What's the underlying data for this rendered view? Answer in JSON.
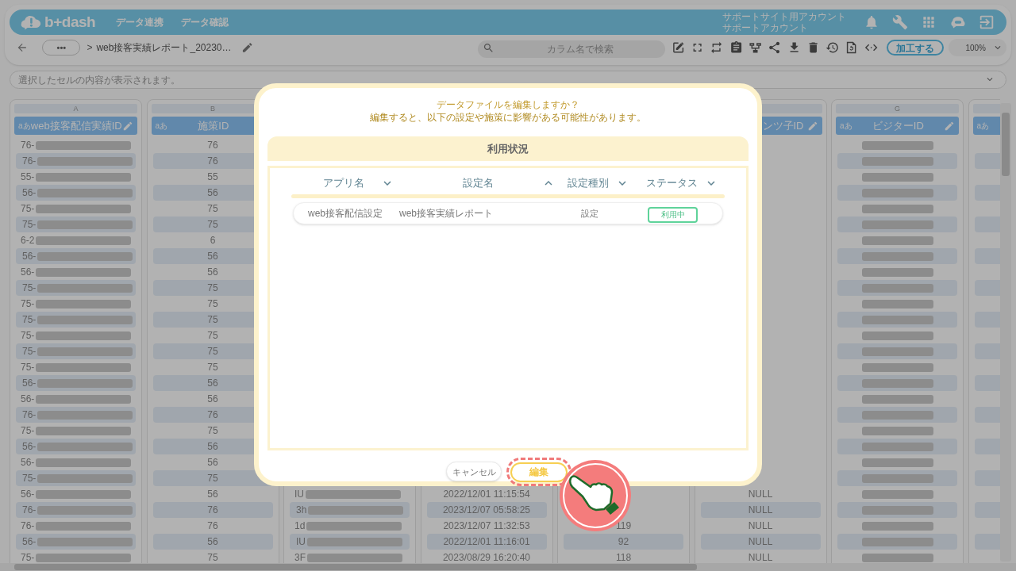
{
  "app_bar": {
    "logo": "b+dash",
    "nav": [
      "データ連携",
      "データ確認"
    ],
    "account": [
      "サポートサイト用アカウント",
      "サポートアカウント"
    ]
  },
  "toolbar": {
    "more": "•••",
    "separator": ">",
    "file_name": "web接客実績レポート_20230…",
    "search": {
      "placeholder": "カラム名で検索"
    },
    "process_button": "加工する",
    "zoom": "100%"
  },
  "cell_bar": {
    "placeholder": "選択したセルの内容が表示されます。"
  },
  "sheet": {
    "columns": [
      {
        "letter": "A",
        "type": "aあ",
        "header": "web接客配信実績ID",
        "kind": "id",
        "editable": true,
        "cells": [
          {
            "text": "76-",
            "blurred": true
          },
          {
            "text": "76-",
            "blurred": true
          },
          {
            "text": "55-",
            "blurred": true
          },
          {
            "text": "56-",
            "blurred": true
          },
          {
            "text": "75-",
            "blurred": true
          },
          {
            "text": "75-",
            "blurred": true
          },
          {
            "text": "6-2",
            "blurred": true
          },
          {
            "text": "56-",
            "blurred": true
          },
          {
            "text": "56-",
            "blurred": true
          },
          {
            "text": "75-",
            "blurred": true
          },
          {
            "text": "75-",
            "blurred": true
          },
          {
            "text": "75-",
            "blurred": true
          },
          {
            "text": "75-",
            "blurred": true
          },
          {
            "text": "75-",
            "blurred": true
          },
          {
            "text": "75-",
            "blurred": true
          },
          {
            "text": "56-",
            "blurred": true
          },
          {
            "text": "56-",
            "blurred": true
          },
          {
            "text": "76-",
            "blurred": true
          },
          {
            "text": "75-",
            "blurred": true
          },
          {
            "text": "56-",
            "blurred": true
          },
          {
            "text": "56-",
            "blurred": true
          },
          {
            "text": "75-",
            "blurred": true
          },
          {
            "text": "56-",
            "blurred": true
          },
          {
            "text": "76-",
            "blurred": true
          },
          {
            "text": "76-",
            "blurred": true
          },
          {
            "text": "56-",
            "blurred": true
          },
          {
            "text": "75-",
            "blurred": true
          }
        ]
      },
      {
        "letter": "B",
        "type": "aあ",
        "header": "施策ID",
        "kind": "number",
        "editable": false,
        "cells": [
          {
            "text": "76"
          },
          {
            "text": "76"
          },
          {
            "text": "55"
          },
          {
            "text": "56"
          },
          {
            "text": "75"
          },
          {
            "text": "75"
          },
          {
            "text": "6"
          },
          {
            "text": "56"
          },
          {
            "text": "56"
          },
          {
            "text": "75"
          },
          {
            "text": "75"
          },
          {
            "text": "75"
          },
          {
            "text": "75"
          },
          {
            "text": "75"
          },
          {
            "text": "75"
          },
          {
            "text": "56"
          },
          {
            "text": "56"
          },
          {
            "text": "76"
          },
          {
            "text": "75"
          },
          {
            "text": "56"
          },
          {
            "text": "56"
          },
          {
            "text": "75"
          },
          {
            "text": "56"
          },
          {
            "text": "76"
          },
          {
            "text": "76"
          },
          {
            "text": "56"
          },
          {
            "text": "75"
          }
        ]
      },
      {
        "kind": "id",
        "cells": [
          {
            "text": "IU",
            "blurred": true
          },
          {
            "text": "3h",
            "blurred": true
          },
          {
            "text": "1d",
            "blurred": true
          },
          {
            "text": "IU",
            "blurred": true
          },
          {
            "text": "3F",
            "blurred": true
          }
        ]
      },
      {
        "kind": "datetime",
        "cells": [
          {
            "text": "2022/12/01 11:15:54"
          },
          {
            "text": "2023/12/07 05:58:25"
          },
          {
            "text": "2023/12/07 11:32:53"
          },
          {
            "text": "2022/12/01 11:16:01"
          },
          {
            "text": "2023/08/29 16:20:40"
          }
        ]
      },
      {
        "kind": "number",
        "cells": [
          {
            "text": "119"
          },
          {
            "text": "92"
          },
          {
            "text": "118"
          }
        ]
      },
      {
        "header": "ンツ子ID",
        "kind": "null",
        "clipped": true,
        "editable": true,
        "cells": [
          {
            "text": "NULL"
          },
          {
            "text": "NULL"
          },
          {
            "text": "NULL"
          },
          {
            "text": "NULL"
          },
          {
            "text": "NULL"
          }
        ]
      },
      {
        "letter": "G",
        "type": "aあ",
        "header": "ビジターID",
        "kind": "masked",
        "editable": true,
        "cells": [
          {
            "blurred": true
          },
          {
            "blurred": true
          },
          {
            "blurred": true
          },
          {
            "blurred": true
          },
          {
            "blurred": true
          },
          {
            "blurred": true
          },
          {
            "blurred": true
          },
          {
            "blurred": true
          },
          {
            "blurred": true
          },
          {
            "blurred": true
          },
          {
            "blurred": true
          },
          {
            "blurred": true
          },
          {
            "blurred": true
          },
          {
            "blurred": true
          },
          {
            "blurred": true
          },
          {
            "blurred": true
          },
          {
            "blurred": true
          },
          {
            "blurred": true
          },
          {
            "blurred": true
          },
          {
            "blurred": true
          },
          {
            "blurred": true
          },
          {
            "blurred": true
          },
          {
            "blurred": true
          },
          {
            "blurred": true
          },
          {
            "blurred": true
          },
          {
            "blurred": true
          },
          {
            "blurred": true
          }
        ]
      },
      {
        "type": "aあ",
        "kind": "edge"
      }
    ]
  },
  "dialog": {
    "title": "データファイルを編集しますか？",
    "message": "編集すると、以下の設定や施策に影響がある可能性があります。",
    "section": "利用状況",
    "columns": [
      {
        "label": "アプリ名",
        "ascending": false
      },
      {
        "label": "設定名",
        "ascending": true
      },
      {
        "label": "設定種別",
        "ascending": false
      },
      {
        "label": "ステータス",
        "ascending": false
      }
    ],
    "rows": [
      {
        "app": "web接客配信設定",
        "setting": "web接客実績レポート",
        "type": "設定",
        "status": "利用中"
      }
    ],
    "buttons": [
      {
        "label": "キャンセル",
        "kind": "cancel",
        "highlighted": false
      },
      {
        "label": "編集",
        "kind": "primary",
        "highlighted": true
      }
    ]
  }
}
